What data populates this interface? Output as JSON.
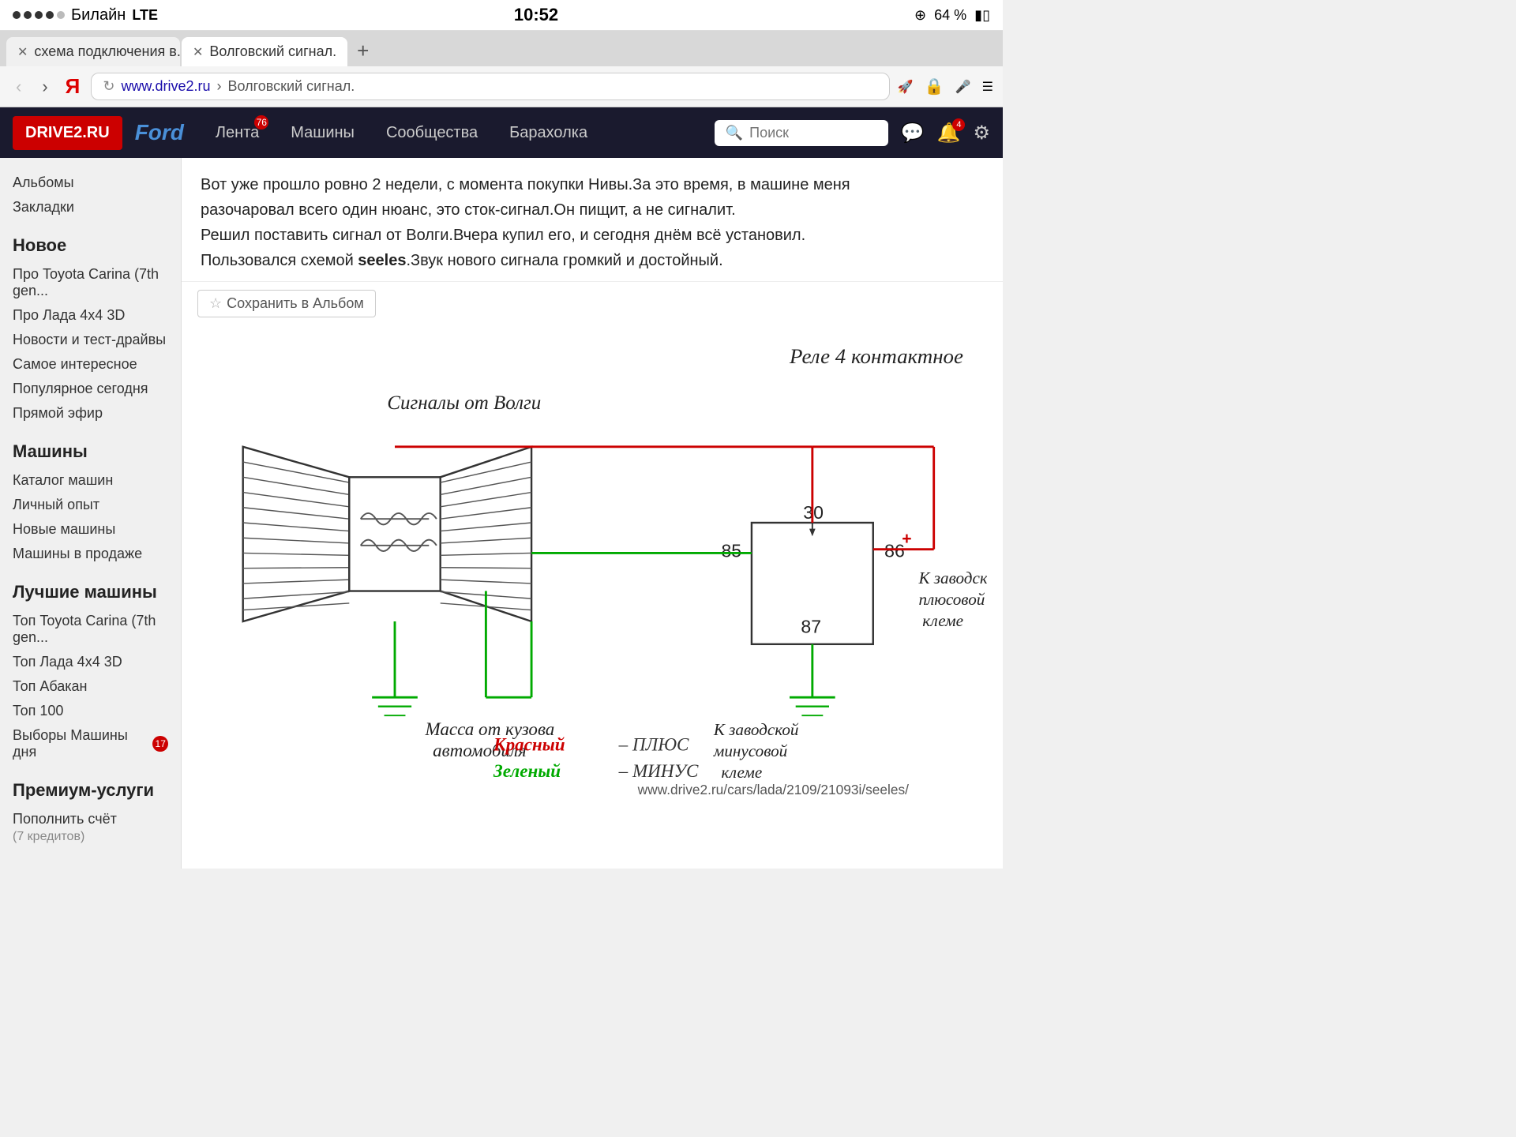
{
  "statusBar": {
    "carrier": "Билайн",
    "network": "LTE",
    "time": "10:52",
    "batteryPercent": "64 %",
    "batteryIcon": "🔋"
  },
  "tabs": [
    {
      "label": "схема подключения в...",
      "active": false,
      "closable": true
    },
    {
      "label": "Волговский сигнал.",
      "active": true,
      "closable": true
    }
  ],
  "tabNew": "+",
  "navBack": "‹",
  "navForward": "›",
  "yandexLogo": "Я",
  "addressBar": {
    "refresh": "↻",
    "domain": "www.drive2.ru",
    "separator": " › ",
    "path": "Волговский сигнал.",
    "lock": "🔒",
    "rocket": "🚀"
  },
  "mainNav": {
    "logo": "DRIVE2.RU",
    "fordLogo": "Ford",
    "items": [
      {
        "label": "Лента",
        "badge": "76"
      },
      {
        "label": "Машины",
        "badge": null
      },
      {
        "label": "Сообщества",
        "badge": null
      },
      {
        "label": "Барахолка",
        "badge": null
      }
    ],
    "searchPlaceholder": "Поиск",
    "icons": {
      "messages": "💬",
      "notifications": "🔔",
      "notifBadge": "4",
      "settings": "⚙"
    }
  },
  "sidebar": {
    "topItems": [
      {
        "label": "Альбомы",
        "badge": null
      },
      {
        "label": "Закладки",
        "badge": null
      }
    ],
    "sections": [
      {
        "title": "Новое",
        "items": [
          {
            "label": "Про Toyota Carina (7th gen...",
            "badge": null
          },
          {
            "label": "Про Лада 4x4 3D",
            "badge": null
          },
          {
            "label": "Новости и тест-драйвы",
            "badge": null
          },
          {
            "label": "Самое интересное",
            "badge": null
          },
          {
            "label": "Популярное сегодня",
            "badge": null
          },
          {
            "label": "Прямой эфир",
            "badge": null
          }
        ]
      },
      {
        "title": "Машины",
        "items": [
          {
            "label": "Каталог машин",
            "badge": null
          },
          {
            "label": "Личный опыт",
            "badge": null
          },
          {
            "label": "Новые машины",
            "badge": null
          },
          {
            "label": "Машины в продаже",
            "badge": null
          }
        ]
      },
      {
        "title": "Лучшие машины",
        "items": [
          {
            "label": "Топ Toyota Carina (7th gen...",
            "badge": null
          },
          {
            "label": "Топ Лада 4x4 3D",
            "badge": null
          },
          {
            "label": "Топ Абакан",
            "badge": null
          },
          {
            "label": "Топ 100",
            "badge": null
          },
          {
            "label": "Выборы Машины дня",
            "badge": "17"
          }
        ]
      },
      {
        "title": "Премиум-услуги",
        "items": [
          {
            "label": "Пополнить счёт\n(7 кредитов)",
            "badge": null
          }
        ]
      }
    ]
  },
  "article": {
    "text1": "Вот уже прошло ровно 2 недели, с момента покупки Нивы.За это время, в машине меня",
    "text2": "разочаровал всего один нюанс, это сток-сигнал.Он пищит, а не сигналит.",
    "text3": "Решил поставить сигнал от Волги.Вчера купил его, и сегодня днём всё установил.",
    "text4pre": "Пользовался схемой ",
    "text4bold": "seeles",
    "text4post": ".Звук нового сигнала громкий и достойный.",
    "saveToAlbum": "Сохранить в Альбом"
  },
  "diagram": {
    "diagramTitle": "Реле 4 контактное",
    "diagramSubtitle": "Сигналы от Волги",
    "label30": "30",
    "label85": "85",
    "label86": "86",
    "label87": "87",
    "labelMass": "Масса от кузова\nавтомобиля",
    "labelKZavPlus": "К заводской\nплюсовой\nклеме",
    "labelKZavMinus": "К заводской\nминусовой\nклеме",
    "legendRed": "Красный – ПЛЮС",
    "legendGreen": "Зеленый – МИНУС",
    "watermark": "www.drive2.ru/cars/lada/2109/21093i/seeles/"
  },
  "colors": {
    "red": "#cc0000",
    "green": "#00aa00",
    "darkRed": "#8B0000",
    "lineRed": "#cc0000",
    "lineGreen": "#00bb00"
  }
}
